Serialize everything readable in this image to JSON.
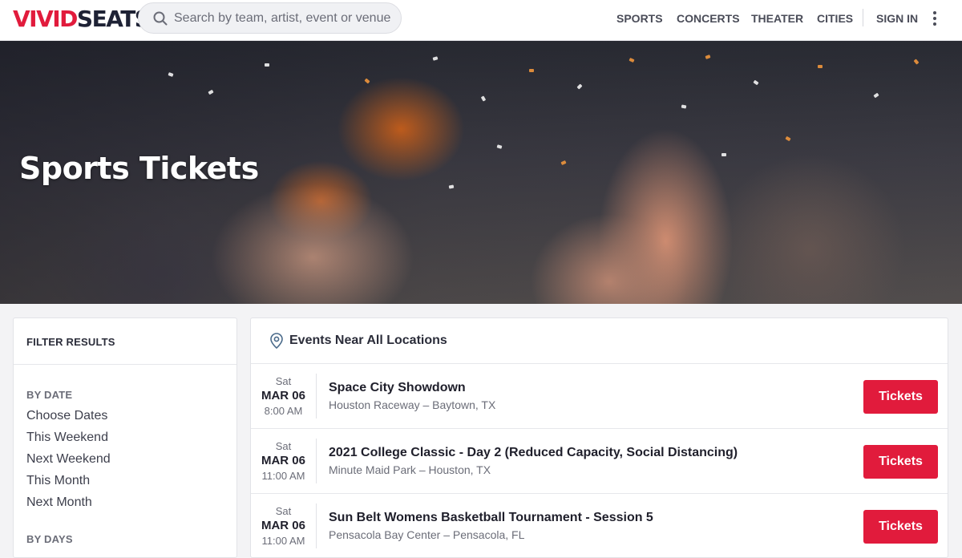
{
  "header": {
    "logo_part1": "VIVID",
    "logo_part2": "SEATS",
    "search_placeholder": "Search by team, artist, event or venue",
    "nav": {
      "sports": "SPORTS",
      "concerts": "CONCERTS",
      "theater": "THEATER",
      "cities": "CITIES",
      "sign_in": "SIGN IN"
    }
  },
  "hero": {
    "title": "Sports Tickets"
  },
  "filters": {
    "heading": "FILTER RESULTS",
    "by_date_label": "BY DATE",
    "date_options": [
      "Choose Dates",
      "This Weekend",
      "Next Weekend",
      "This Month",
      "Next Month"
    ],
    "by_days_label": "BY DAYS"
  },
  "events": {
    "heading": "Events Near All Locations",
    "button_label": "Tickets",
    "items": [
      {
        "dow": "Sat",
        "date": "MAR 06",
        "time": "8:00 AM",
        "name": "Space City Showdown",
        "venue": "Houston Raceway – Baytown, TX"
      },
      {
        "dow": "Sat",
        "date": "MAR 06",
        "time": "11:00 AM",
        "name": "2021 College Classic - Day 2 (Reduced Capacity, Social Distancing)",
        "venue": "Minute Maid Park – Houston, TX"
      },
      {
        "dow": "Sat",
        "date": "MAR 06",
        "time": "11:00 AM",
        "name": "Sun Belt Womens Basketball Tournament - Session 5",
        "venue": "Pensacola Bay Center – Pensacola, FL"
      }
    ]
  },
  "colors": {
    "brand_red": "#e11b3c",
    "brand_navy": "#1e2235"
  },
  "icons": {
    "search": "search-icon",
    "location": "location-pin-icon",
    "menu": "kebab-menu-icon"
  }
}
